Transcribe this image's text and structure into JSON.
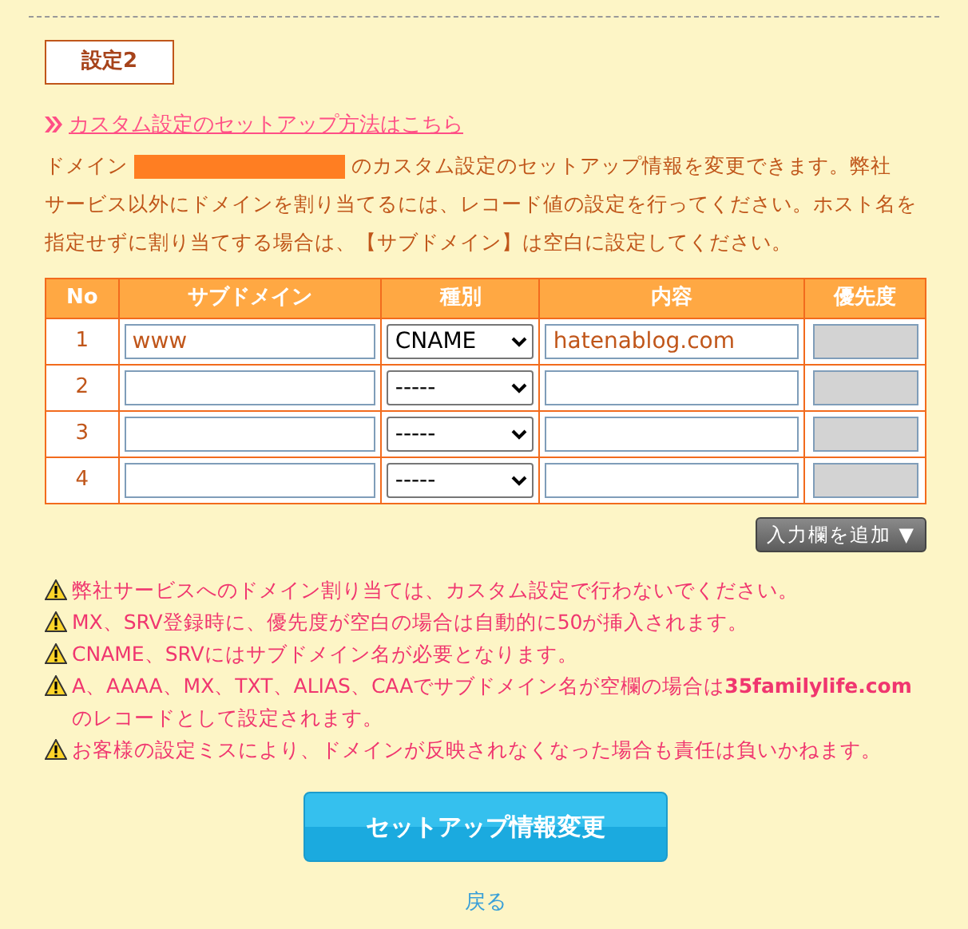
{
  "section_title": "設定2",
  "help_link": "カスタム設定のセットアップ方法はこちら",
  "description": {
    "prefix": "ドメイン",
    "suffix": "のカスタム設定のセットアップ情報を変更できます。弊社",
    "continuation": "サービス以外にドメインを割り当てるには、レコード値の設定を行ってください。ホスト名を指定せずに割り当てする場合は、【サブドメイン】は空白に設定してください。"
  },
  "table": {
    "columns": [
      "No",
      "サブドメイン",
      "種別",
      "内容",
      "優先度"
    ],
    "rows": [
      {
        "no": "1",
        "subdomain": "www",
        "type": "CNAME",
        "content": "hatenablog.com",
        "priority_disabled": true
      },
      {
        "no": "2",
        "subdomain": "",
        "type": "-----",
        "content": "",
        "priority_disabled": true
      },
      {
        "no": "3",
        "subdomain": "",
        "type": "-----",
        "content": "",
        "priority_disabled": true
      },
      {
        "no": "4",
        "subdomain": "",
        "type": "-----",
        "content": "",
        "priority_disabled": true
      }
    ]
  },
  "add_button": {
    "label": "入力欄を追加",
    "caret": "▼"
  },
  "notes": [
    "弊社サービスへのドメイン割り当ては、カスタム設定で行わないでください。",
    "MX、SRV登録時に、優先度が空白の場合は自動的に50が挿入されます。",
    "CNAME、SRVにはサブドメイン名が必要となります。",
    "A、AAAA、MX、TXT、ALIAS、CAAでサブドメイン名が空欄の場合は**35familylife.com**のレコードとして設定されます。",
    "お客様の設定ミスにより、ドメインが反映されなくなった場合も責任は負いかねます。"
  ],
  "submit_button": "セットアップ情報変更",
  "back_link": "戻る"
}
